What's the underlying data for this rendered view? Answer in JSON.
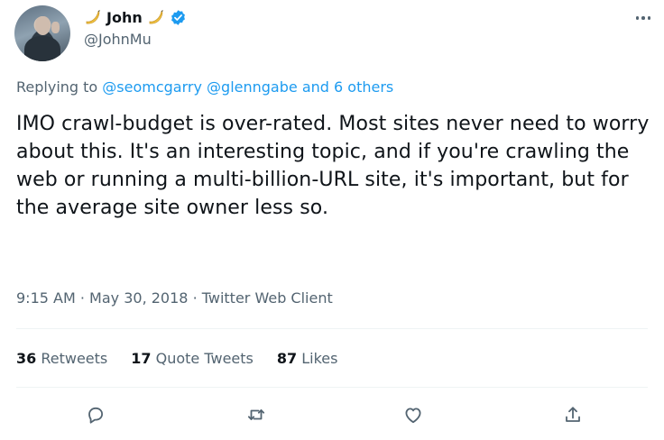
{
  "author": {
    "name": "John",
    "handle": "@JohnMu",
    "name_emoji": "banana-icon",
    "verified": true
  },
  "reply": {
    "prefix": "Replying to",
    "mention1": "@seomcgarry",
    "mention2": "@glenngabe",
    "others": "and 6 others"
  },
  "tweet": {
    "text": "IMO crawl-budget is over-rated. Most sites never need to worry about this. It's an interesting topic, and if you're crawling the web or running a multi-billion-URL site, it's important, but for the average site owner less so.",
    "time": "9:15 AM",
    "date": "May 30, 2018",
    "client": "Twitter Web Client",
    "separator": "·"
  },
  "stats": {
    "retweets_count": "36",
    "retweets_label": "Retweets",
    "quotes_count": "17",
    "quotes_label": "Quote Tweets",
    "likes_count": "87",
    "likes_label": "Likes"
  },
  "colors": {
    "accent": "#1d9bf0",
    "text": "#0f1419",
    "secondary": "#536471",
    "divider": "#eff3f4"
  }
}
